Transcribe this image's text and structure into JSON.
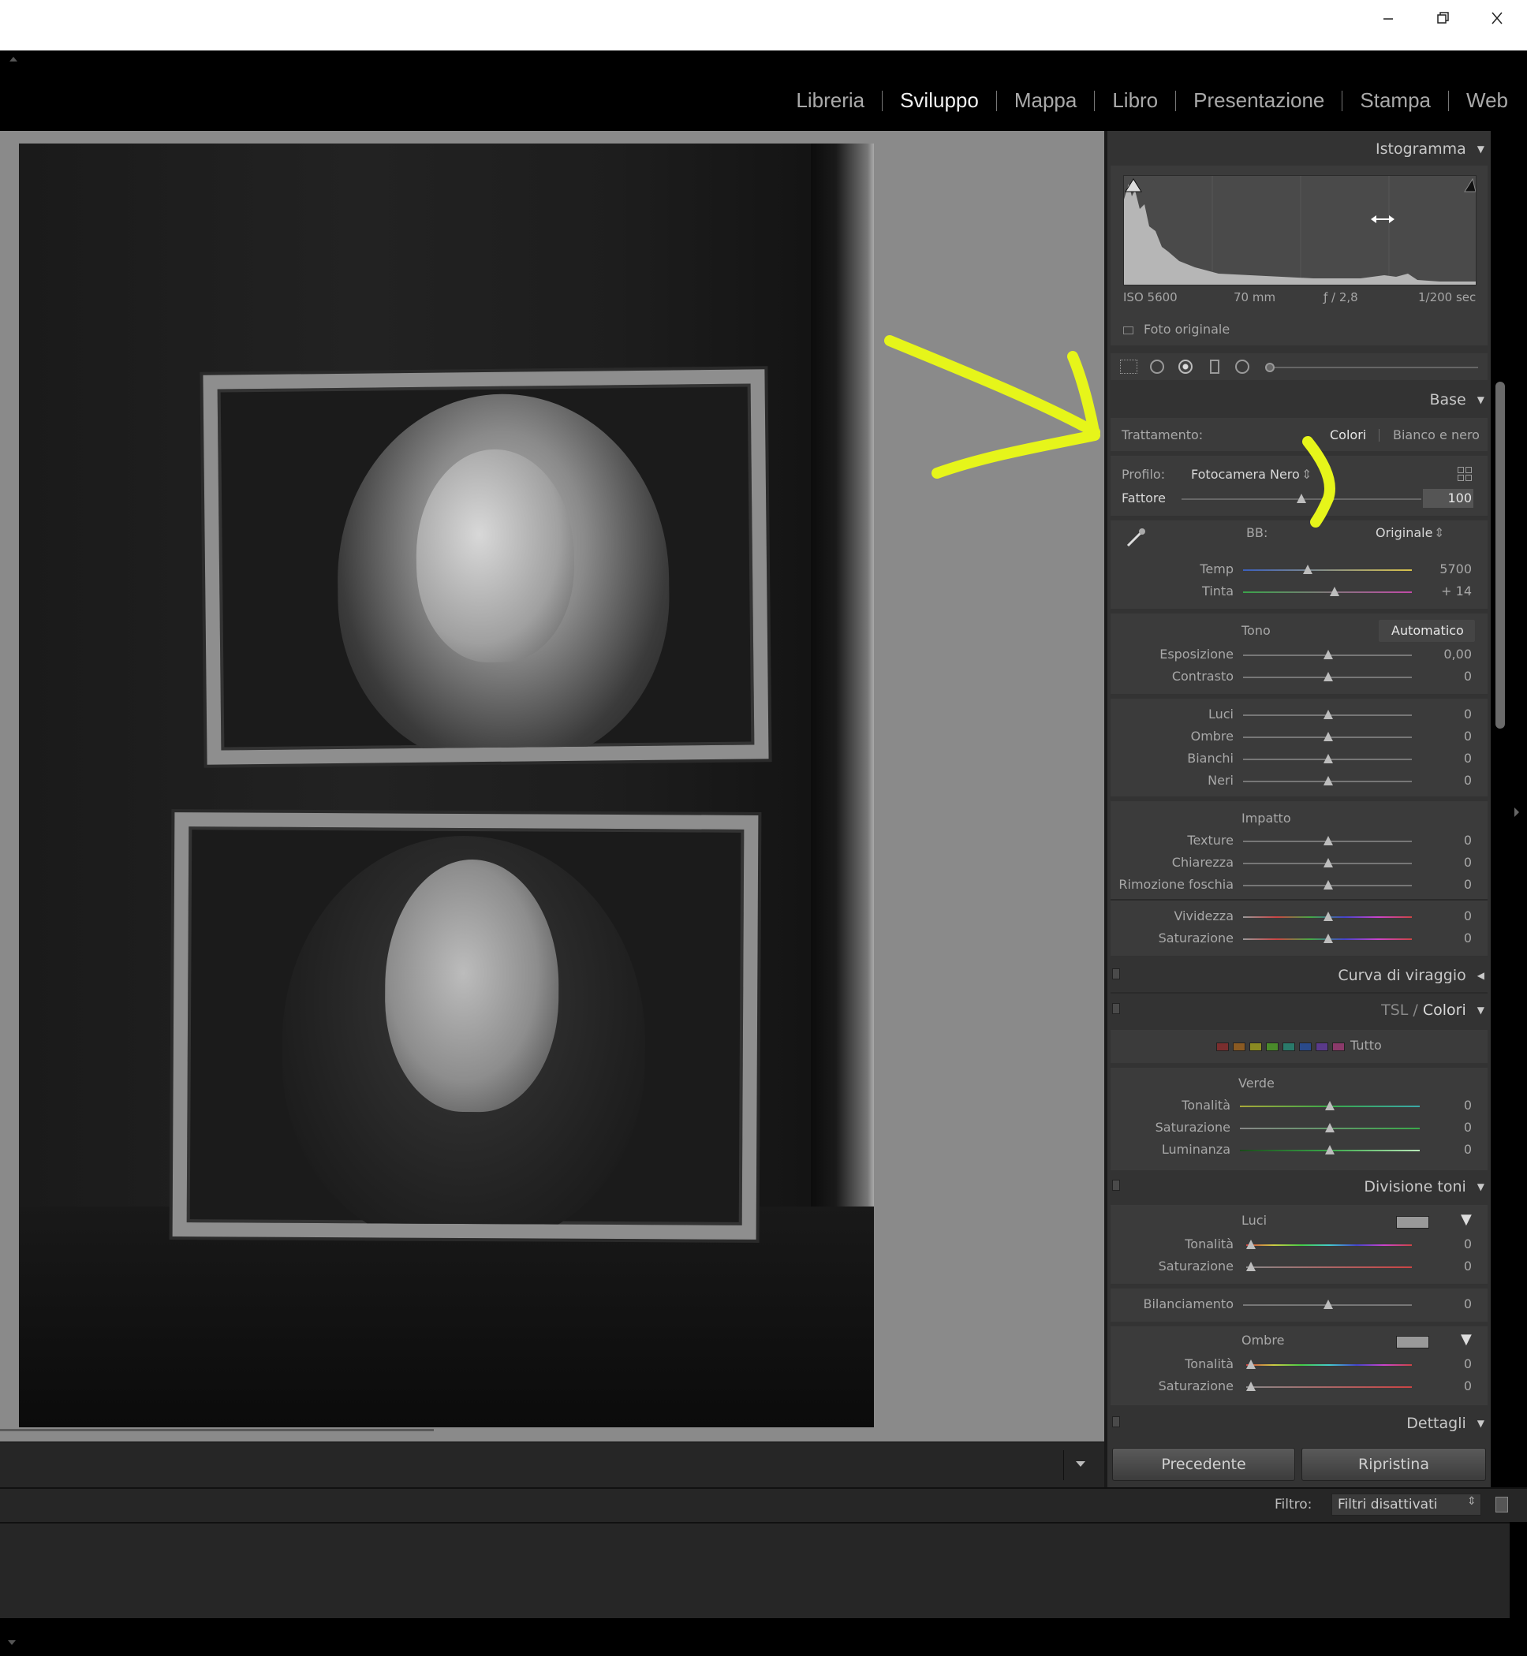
{
  "window": {
    "controls": [
      "minimize-icon",
      "restore-icon",
      "close-icon"
    ]
  },
  "modules": [
    "Libreria",
    "Sviluppo",
    "Mappa",
    "Libro",
    "Presentazione",
    "Stampa",
    "Web"
  ],
  "active_module": "Sviluppo",
  "histogram": {
    "title": "Istogramma",
    "iso": "ISO 5600",
    "focal": "70 mm",
    "aperture": "ƒ / 2,8",
    "shutter": "1/200 sec",
    "original_photo": "Foto originale"
  },
  "base": {
    "title": "Base",
    "treatment_label": "Trattamento:",
    "treatment_color": "Colori",
    "treatment_bw": "Bianco e nero",
    "profile_label": "Profilo:",
    "profile_value": "Fotocamera Nero",
    "amount_label": "Fattore",
    "amount_value": "100",
    "wb_label": "BB:",
    "wb_value": "Originale",
    "temp_label": "Temp",
    "temp_value": "5700",
    "tint_label": "Tinta",
    "tint_value": "+ 14",
    "tone_label": "Tono",
    "auto_label": "Automatico",
    "exposure_label": "Esposizione",
    "exposure_value": "0,00",
    "contrast_label": "Contrasto",
    "contrast_value": "0",
    "highlights_label": "Luci",
    "highlights_value": "0",
    "shadows_label": "Ombre",
    "shadows_value": "0",
    "whites_label": "Bianchi",
    "whites_value": "0",
    "blacks_label": "Neri",
    "blacks_value": "0",
    "presence_label": "Impatto",
    "texture_label": "Texture",
    "texture_value": "0",
    "clarity_label": "Chiarezza",
    "clarity_value": "0",
    "dehaze_label": "Rimozione foschia",
    "dehaze_value": "0",
    "vibrance_label": "Vividezza",
    "vibrance_value": "0",
    "saturation_label": "Saturazione",
    "saturation_value": "0"
  },
  "tone_curve": {
    "title": "Curva di viraggio"
  },
  "hsl": {
    "title_a": "TSL",
    "slash": "/",
    "title_b": "Colori",
    "all_label": "Tutto",
    "swatches": [
      "#7a2e2e",
      "#8a5a22",
      "#8a8a22",
      "#4a8a2a",
      "#2a7a6a",
      "#2a4a8a",
      "#5a3a8a",
      "#8a3a6a"
    ],
    "color_name": "Verde",
    "hue_label": "Tonalità",
    "hue_value": "0",
    "sat_label": "Saturazione",
    "sat_value": "0",
    "lum_label": "Luminanza",
    "lum_value": "0"
  },
  "split_toning": {
    "title": "Divisione toni",
    "highlights": "Luci",
    "h_hue_label": "Tonalità",
    "h_hue_value": "0",
    "h_sat_label": "Saturazione",
    "h_sat_value": "0",
    "balance_label": "Bilanciamento",
    "balance_value": "0",
    "shadows": "Ombre",
    "s_hue_label": "Tonalità",
    "s_hue_value": "0",
    "s_sat_label": "Saturazione",
    "s_sat_value": "0"
  },
  "details": {
    "title": "Dettagli"
  },
  "buttons": {
    "previous": "Precedente",
    "reset": "Ripristina"
  },
  "filter": {
    "label": "Filtro:",
    "value": "Filtri disattivati"
  },
  "annotation_color": "#e6f51a"
}
